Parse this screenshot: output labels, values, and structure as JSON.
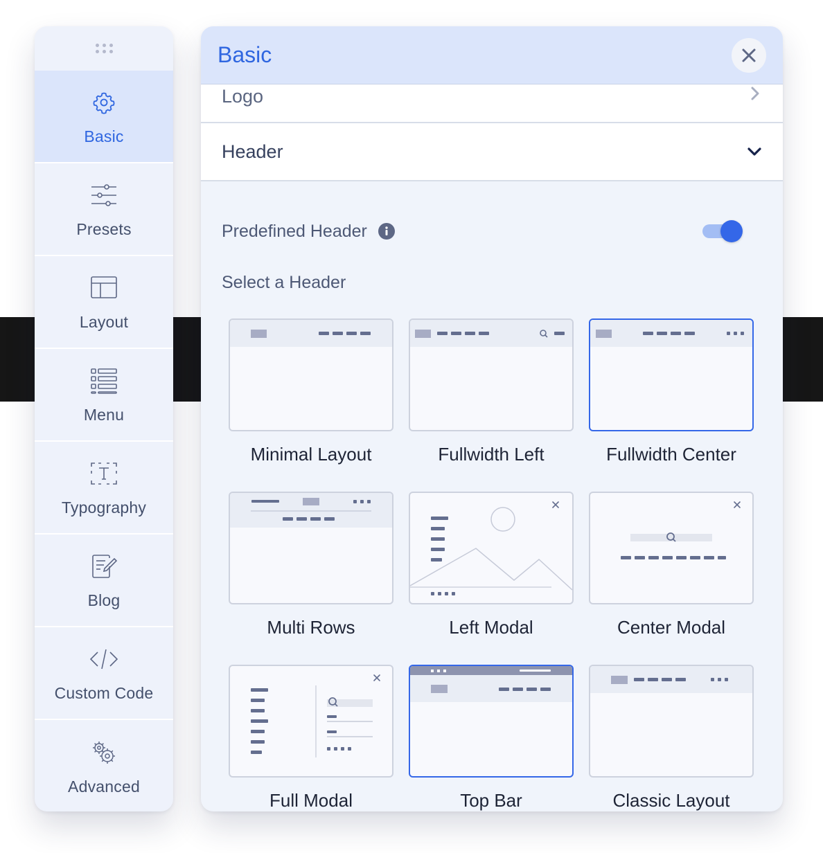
{
  "sidebar": {
    "items": [
      {
        "label": "Basic",
        "icon": "gear-icon",
        "active": true
      },
      {
        "label": "Presets",
        "icon": "sliders-icon"
      },
      {
        "label": "Layout",
        "icon": "layout-icon"
      },
      {
        "label": "Menu",
        "icon": "menu-list-icon"
      },
      {
        "label": "Typography",
        "icon": "typography-icon"
      },
      {
        "label": "Blog",
        "icon": "blog-edit-icon"
      },
      {
        "label": "Custom Code",
        "icon": "code-icon"
      },
      {
        "label": "Advanced",
        "icon": "gears-icon"
      }
    ]
  },
  "panel": {
    "title": "Basic",
    "sections": {
      "logo": "Logo",
      "header": "Header"
    },
    "predefined_header": {
      "label": "Predefined Header",
      "enabled": true
    },
    "select_label": "Select a Header",
    "headers": [
      {
        "name": "Minimal Layout",
        "selected": false
      },
      {
        "name": "Fullwidth Left",
        "selected": false
      },
      {
        "name": "Fullwidth Center",
        "selected": true
      },
      {
        "name": "Multi Rows",
        "selected": false
      },
      {
        "name": "Left Modal",
        "selected": false
      },
      {
        "name": "Center Modal",
        "selected": false
      },
      {
        "name": "Full Modal",
        "selected": false
      },
      {
        "name": "Top Bar",
        "selected": true
      },
      {
        "name": "Classic Layout",
        "selected": false
      }
    ]
  },
  "colors": {
    "accent": "#3467e8",
    "sidebar_bg": "#eef2fb",
    "active_bg": "#dbe5fb",
    "text": "#44506c"
  }
}
